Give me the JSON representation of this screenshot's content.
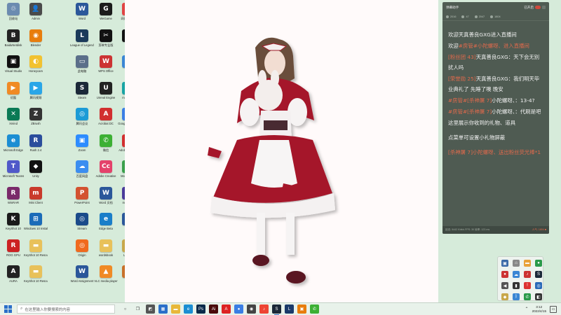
{
  "desktop_icons": [
    {
      "label": "回收站",
      "icon": "recycle-bin-icon",
      "color": "#6b8bb0",
      "glyph": "♲"
    },
    {
      "label": "Admin",
      "icon": "user-folder-icon",
      "color": "#4a4a4a",
      "glyph": "👤"
    },
    {
      "label": "Word",
      "icon": "word-icon",
      "color": "#2b579a",
      "glyph": "W"
    },
    {
      "label": "WeGame",
      "icon": "wegame-icon",
      "color": "#1b1b1b",
      "glyph": "G"
    },
    {
      "label": "网易云音乐",
      "icon": "netease-music-icon",
      "color": "#e04444",
      "glyph": "♪"
    },
    {
      "label": "BaiduNetdisk",
      "icon": "baidu-netdisk-icon",
      "color": "#222",
      "glyph": "B"
    },
    {
      "label": "Blender",
      "icon": "blender-icon",
      "color": "#e87d0d",
      "glyph": "◉"
    },
    {
      "label": "League of Legends",
      "icon": "lol-icon",
      "color": "#1b3a5a",
      "glyph": "L"
    },
    {
      "label": "剪映专业版",
      "icon": "jianying-icon",
      "color": "#111",
      "glyph": "✂"
    },
    {
      "label": "QQ",
      "icon": "qq-icon",
      "color": "#111",
      "glyph": "Q"
    },
    {
      "label": "Visual Studio",
      "icon": "visual-studio-icon",
      "color": "#111",
      "glyph": "▣"
    },
    {
      "label": "Honeycam",
      "icon": "honeycam-icon",
      "color": "#f2c230",
      "glyph": "◐"
    },
    {
      "label": "此电脑",
      "icon": "this-pc-icon",
      "color": "#5b6f8a",
      "glyph": "▭"
    },
    {
      "label": "WPS Office",
      "icon": "wps-icon",
      "color": "#c33",
      "glyph": "W"
    },
    {
      "label": "迅雷",
      "icon": "xunlei-icon",
      "color": "#3a86d4",
      "glyph": "✦"
    },
    {
      "label": "优酷",
      "icon": "youku-icon",
      "color": "#f08a24",
      "glyph": "▶"
    },
    {
      "label": "腾讯视频",
      "icon": "tencent-video-icon",
      "color": "#2aa6e8",
      "glyph": "▶"
    },
    {
      "label": "Steam",
      "icon": "steam-icon",
      "color": "#1b2838",
      "glyph": "S"
    },
    {
      "label": "Unreal Engine",
      "icon": "unreal-icon",
      "color": "#222",
      "glyph": "U"
    },
    {
      "label": "mapp-ZH",
      "icon": "maya-icon",
      "color": "#18a4a4",
      "glyph": "M"
    },
    {
      "label": "Xmind",
      "icon": "xmind-icon",
      "color": "#0a7a55",
      "glyph": "✕"
    },
    {
      "label": "ZBrush",
      "icon": "zbrush-icon",
      "color": "#333",
      "glyph": "Z"
    },
    {
      "label": "腾讯会议",
      "icon": "tencent-meeting-icon",
      "color": "#1c9bd6",
      "glyph": "◎"
    },
    {
      "label": "Acrobat DC",
      "icon": "acrobat-icon",
      "color": "#d12f2f",
      "glyph": "A"
    },
    {
      "label": "Google Chrome",
      "icon": "chrome-icon",
      "color": "#3a7ee4",
      "glyph": "●"
    },
    {
      "label": "Microsoft Edge",
      "icon": "edge-icon",
      "color": "#1b8ed3",
      "glyph": "e"
    },
    {
      "label": "Rush 2.4",
      "icon": "rush-icon",
      "color": "#2a4d9c",
      "glyph": "R"
    },
    {
      "label": "Zoom",
      "icon": "zoom-icon",
      "color": "#2d8cff",
      "glyph": "▣"
    },
    {
      "label": "微信",
      "icon": "wechat-icon",
      "color": "#3cb034",
      "glyph": "✆"
    },
    {
      "label": "Adobe Acrobat",
      "icon": "adobe-acrobat-icon",
      "color": "#d12f2f",
      "glyph": "A"
    },
    {
      "label": "Microsoft Teams",
      "icon": "teams-icon",
      "color": "#5059c9",
      "glyph": "T"
    },
    {
      "label": "Unity",
      "icon": "unity-icon",
      "color": "#111",
      "glyph": "◆"
    },
    {
      "label": "百度网盘",
      "icon": "baidu-pan-icon",
      "color": "#3b8ef0",
      "glyph": "☁"
    },
    {
      "label": "Adobe Creative",
      "icon": "creative-cloud-icon",
      "color": "#e4426b",
      "glyph": "Cc"
    },
    {
      "label": "Mo Chrome",
      "icon": "chrome-alt-icon",
      "color": "#3aa04b",
      "glyph": "●"
    },
    {
      "label": "WinRAR",
      "icon": "winrar-icon",
      "color": "#7a2a6a",
      "glyph": "R"
    },
    {
      "label": "Mini Client",
      "icon": "mini-client-icon",
      "color": "#c93a2b",
      "glyph": "m"
    },
    {
      "label": "PowerPoint",
      "icon": "powerpoint-icon",
      "color": "#d35230",
      "glyph": "P"
    },
    {
      "label": "Word 文档",
      "icon": "word-doc-icon",
      "color": "#2b579a",
      "glyph": "W"
    },
    {
      "label": "Insomnia",
      "icon": "insomnia-icon",
      "color": "#4a3a9a",
      "glyph": "◉"
    },
    {
      "label": "KeyShot 10",
      "icon": "keyshot-icon",
      "color": "#1a1a1a",
      "glyph": "K"
    },
    {
      "label": "Windows 10 Installer",
      "icon": "windows-installer-icon",
      "color": "#1a6bb8",
      "glyph": "⊞"
    },
    {
      "label": "Stream",
      "icon": "stream-icon",
      "color": "#1a4a8a",
      "glyph": "◎"
    },
    {
      "label": "Edge Beta",
      "icon": "edge-beta-icon",
      "color": "#1a7ec9",
      "glyph": "e"
    },
    {
      "label": "Word",
      "icon": "word-file-icon",
      "color": "#2b579a",
      "glyph": "W"
    },
    {
      "label": "ROG GPU",
      "icon": "rog-icon",
      "color": "#c22",
      "glyph": "R"
    },
    {
      "label": "KeyShot 10 Resources",
      "icon": "folder-icon",
      "color": "#e8c15a",
      "glyph": "▬"
    },
    {
      "label": "Origin",
      "icon": "origin-icon",
      "color": "#f06a1e",
      "glyph": "◎"
    },
    {
      "label": "wordsbook",
      "icon": "folder-alt-icon",
      "color": "#e8c15a",
      "glyph": "▬"
    },
    {
      "label": "League",
      "icon": "league-client-icon",
      "color": "#c8a84b",
      "glyph": "L"
    },
    {
      "label": "AURA",
      "icon": "aura-icon",
      "color": "#222",
      "glyph": "A"
    },
    {
      "label": "KeyShot 10 Resources",
      "icon": "folder-2-icon",
      "color": "#e8c15a",
      "glyph": "▬"
    },
    {
      "label": "Word Assignment",
      "icon": "word-assignment-icon",
      "color": "#2b579a",
      "glyph": "W"
    },
    {
      "label": "VLC media player",
      "icon": "vlc-icon",
      "color": "#f08a24",
      "glyph": "▲"
    },
    {
      "label": "游戏",
      "icon": "game-icon",
      "color": "#c8702a",
      "glyph": "☺"
    }
  ],
  "chat": {
    "title": "弹幕助手",
    "toggle_label": "已开启",
    "stats": [
      "2016",
      "47",
      "2047",
      "1804"
    ],
    "messages": [
      {
        "user": "",
        "text": "欢迎天真善良GXG进入直播间"
      },
      {
        "user": "欢迎",
        "text": "",
        "tag": "#房管#小陀螺呀、进入直播间"
      },
      {
        "user": "[粉丝团 43]",
        "text": "天真善良GXG：天下会无别扰人吗"
      },
      {
        "user": "[荣誉勋 25]",
        "text": "天真善良GXG：我们明天毕业典礼了 先睡了噢 晚安"
      },
      {
        "user": "#房管#[杀神屠 7]",
        "text": "小陀螺呀、：13-4?"
      },
      {
        "user": "#房管#[杀神屠 7]",
        "text": "小陀螺呀、：代刷是吧"
      },
      {
        "user": "",
        "text": "这里展示你收到的礼物、道具"
      },
      {
        "user": "",
        "text": "点菜单可设置小礼物屏蔽"
      },
      {
        "user": "[杀神屠 7]",
        "text": "小陀螺呀、送出粉丝荧光棒*1"
      }
    ],
    "footer_left": "延迟: 5442 Kbit/s FPS: 30 帧率: 123 ms",
    "footer_right": "人气: 1804 ■"
  },
  "taskbar": {
    "search_placeholder": "在这里输入你要搜索的内容",
    "time": "3:12",
    "date": "2022/4/15"
  },
  "colors": {
    "desktop_bg": "#d6ebda",
    "chat_bg": "#4f5b52",
    "chat_accent": "#e26a4c"
  }
}
